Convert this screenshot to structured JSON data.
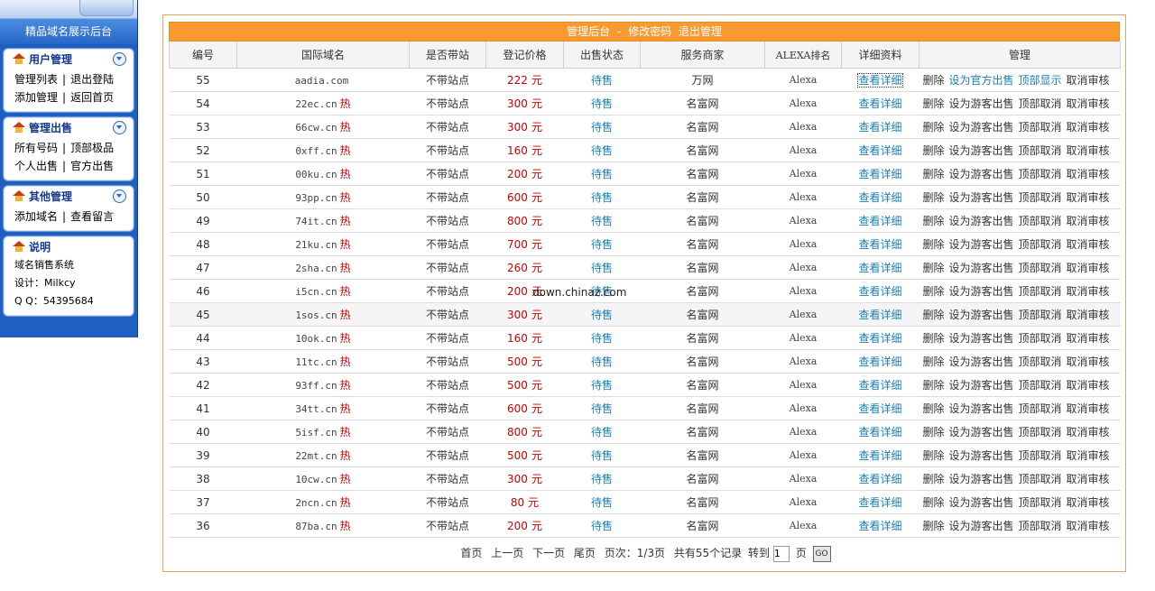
{
  "sidebar": {
    "title": "精品域名展示后台",
    "panels": {
      "user": {
        "title": "用户管理",
        "links": [
          "管理列表",
          "退出登陆",
          "添加管理",
          "返回首页"
        ]
      },
      "sale": {
        "title": "管理出售",
        "links": [
          "所有号码",
          "顶部极品",
          "个人出售",
          "官方出售"
        ]
      },
      "other": {
        "title": "其他管理",
        "links": [
          "添加域名",
          "查看留言"
        ]
      },
      "info": {
        "title": "说明",
        "lines": [
          "域名销售系统",
          "设计：Milkcy",
          "Q  Q：54395684"
        ]
      }
    }
  },
  "header": {
    "title": "管理后台",
    "sep": "-",
    "change_password": "修改密码",
    "logout": "退出管理"
  },
  "columns": [
    "编号",
    "国际域名",
    "是否带站",
    "登记价格",
    "出售状态",
    "服务商家",
    "ALEXA排名",
    "详细资料",
    "管理"
  ],
  "rows": [
    {
      "id": "55",
      "domain": "aadia.com",
      "hot": "",
      "site": "不带站点",
      "price": "222",
      "unit": "元",
      "status": "待售",
      "provider": "万网",
      "alexa": "Alexa",
      "detail": "查看详细",
      "m1": "删除",
      "m2": "设为官方出售",
      "m3": "顶部显示",
      "m4": "取消审核"
    },
    {
      "id": "54",
      "domain": "22ec.cn",
      "hot": "热",
      "site": "不带站点",
      "price": "300",
      "unit": "元",
      "status": "待售",
      "provider": "名富网",
      "alexa": "Alexa",
      "detail": "查看详细",
      "m1": "删除",
      "m2": "设为游客出售",
      "m3": "顶部取消",
      "m4": "取消审核"
    },
    {
      "id": "53",
      "domain": "66cw.cn",
      "hot": "热",
      "site": "不带站点",
      "price": "300",
      "unit": "元",
      "status": "待售",
      "provider": "名富网",
      "alexa": "Alexa",
      "detail": "查看详细",
      "m1": "删除",
      "m2": "设为游客出售",
      "m3": "顶部取消",
      "m4": "取消审核"
    },
    {
      "id": "52",
      "domain": "0xff.cn",
      "hot": "热",
      "site": "不带站点",
      "price": "160",
      "unit": "元",
      "status": "待售",
      "provider": "名富网",
      "alexa": "Alexa",
      "detail": "查看详细",
      "m1": "删除",
      "m2": "设为游客出售",
      "m3": "顶部取消",
      "m4": "取消审核"
    },
    {
      "id": "51",
      "domain": "00ku.cn",
      "hot": "热",
      "site": "不带站点",
      "price": "200",
      "unit": "元",
      "status": "待售",
      "provider": "名富网",
      "alexa": "Alexa",
      "detail": "查看详细",
      "m1": "删除",
      "m2": "设为游客出售",
      "m3": "顶部取消",
      "m4": "取消审核"
    },
    {
      "id": "50",
      "domain": "93pp.cn",
      "hot": "热",
      "site": "不带站点",
      "price": "600",
      "unit": "元",
      "status": "待售",
      "provider": "名富网",
      "alexa": "Alexa",
      "detail": "查看详细",
      "m1": "删除",
      "m2": "设为游客出售",
      "m3": "顶部取消",
      "m4": "取消审核"
    },
    {
      "id": "49",
      "domain": "74it.cn",
      "hot": "热",
      "site": "不带站点",
      "price": "800",
      "unit": "元",
      "status": "待售",
      "provider": "名富网",
      "alexa": "Alexa",
      "detail": "查看详细",
      "m1": "删除",
      "m2": "设为游客出售",
      "m3": "顶部取消",
      "m4": "取消审核"
    },
    {
      "id": "48",
      "domain": "21ku.cn",
      "hot": "热",
      "site": "不带站点",
      "price": "700",
      "unit": "元",
      "status": "待售",
      "provider": "名富网",
      "alexa": "Alexa",
      "detail": "查看详细",
      "m1": "删除",
      "m2": "设为游客出售",
      "m3": "顶部取消",
      "m4": "取消审核"
    },
    {
      "id": "47",
      "domain": "2sha.cn",
      "hot": "热",
      "site": "不带站点",
      "price": "260",
      "unit": "元",
      "status": "待售",
      "provider": "名富网",
      "alexa": "Alexa",
      "detail": "查看详细",
      "m1": "删除",
      "m2": "设为游客出售",
      "m3": "顶部取消",
      "m4": "取消审核"
    },
    {
      "id": "46",
      "domain": "i5cn.cn",
      "hot": "热",
      "site": "不带站点",
      "price": "200",
      "unit": "元",
      "status": "待售",
      "provider": "名富网",
      "alexa": "Alexa",
      "detail": "查看详细",
      "m1": "删除",
      "m2": "设为游客出售",
      "m3": "顶部取消",
      "m4": "取消审核"
    },
    {
      "id": "45",
      "domain": "1sos.cn",
      "hot": "热",
      "site": "不带站点",
      "price": "300",
      "unit": "元",
      "status": "待售",
      "provider": "名富网",
      "alexa": "Alexa",
      "detail": "查看详细",
      "m1": "删除",
      "m2": "设为游客出售",
      "m3": "顶部取消",
      "m4": "取消审核"
    },
    {
      "id": "44",
      "domain": "10ok.cn",
      "hot": "热",
      "site": "不带站点",
      "price": "160",
      "unit": "元",
      "status": "待售",
      "provider": "名富网",
      "alexa": "Alexa",
      "detail": "查看详细",
      "m1": "删除",
      "m2": "设为游客出售",
      "m3": "顶部取消",
      "m4": "取消审核"
    },
    {
      "id": "43",
      "domain": "11tc.cn",
      "hot": "热",
      "site": "不带站点",
      "price": "500",
      "unit": "元",
      "status": "待售",
      "provider": "名富网",
      "alexa": "Alexa",
      "detail": "查看详细",
      "m1": "删除",
      "m2": "设为游客出售",
      "m3": "顶部取消",
      "m4": "取消审核"
    },
    {
      "id": "42",
      "domain": "93ff.cn",
      "hot": "热",
      "site": "不带站点",
      "price": "500",
      "unit": "元",
      "status": "待售",
      "provider": "名富网",
      "alexa": "Alexa",
      "detail": "查看详细",
      "m1": "删除",
      "m2": "设为游客出售",
      "m3": "顶部取消",
      "m4": "取消审核"
    },
    {
      "id": "41",
      "domain": "34tt.cn",
      "hot": "热",
      "site": "不带站点",
      "price": "600",
      "unit": "元",
      "status": "待售",
      "provider": "名富网",
      "alexa": "Alexa",
      "detail": "查看详细",
      "m1": "删除",
      "m2": "设为游客出售",
      "m3": "顶部取消",
      "m4": "取消审核"
    },
    {
      "id": "40",
      "domain": "5isf.cn",
      "hot": "热",
      "site": "不带站点",
      "price": "800",
      "unit": "元",
      "status": "待售",
      "provider": "名富网",
      "alexa": "Alexa",
      "detail": "查看详细",
      "m1": "删除",
      "m2": "设为游客出售",
      "m3": "顶部取消",
      "m4": "取消审核"
    },
    {
      "id": "39",
      "domain": "22mt.cn",
      "hot": "热",
      "site": "不带站点",
      "price": "500",
      "unit": "元",
      "status": "待售",
      "provider": "名富网",
      "alexa": "Alexa",
      "detail": "查看详细",
      "m1": "删除",
      "m2": "设为游客出售",
      "m3": "顶部取消",
      "m4": "取消审核"
    },
    {
      "id": "38",
      "domain": "10cw.cn",
      "hot": "热",
      "site": "不带站点",
      "price": "300",
      "unit": "元",
      "status": "待售",
      "provider": "名富网",
      "alexa": "Alexa",
      "detail": "查看详细",
      "m1": "删除",
      "m2": "设为游客出售",
      "m3": "顶部取消",
      "m4": "取消审核"
    },
    {
      "id": "37",
      "domain": "2ncn.cn",
      "hot": "热",
      "site": "不带站点",
      "price": "80",
      "unit": "元",
      "status": "待售",
      "provider": "名富网",
      "alexa": "Alexa",
      "detail": "查看详细",
      "m1": "删除",
      "m2": "设为游客出售",
      "m3": "顶部取消",
      "m4": "取消审核"
    },
    {
      "id": "36",
      "domain": "87ba.cn",
      "hot": "热",
      "site": "不带站点",
      "price": "200",
      "unit": "元",
      "status": "待售",
      "provider": "名富网",
      "alexa": "Alexa",
      "detail": "查看详细",
      "m1": "删除",
      "m2": "设为游客出售",
      "m3": "顶部取消",
      "m4": "取消审核"
    }
  ],
  "pager": {
    "first": "首页",
    "prev": "上一页",
    "next": "下一页",
    "last": "尾页",
    "pages": "页次：1/3页",
    "total": "共有55个记录",
    "goto": "转到",
    "page_value": "1",
    "page_unit": "页",
    "go": "GO"
  },
  "watermark": "down.chinaz.com"
}
